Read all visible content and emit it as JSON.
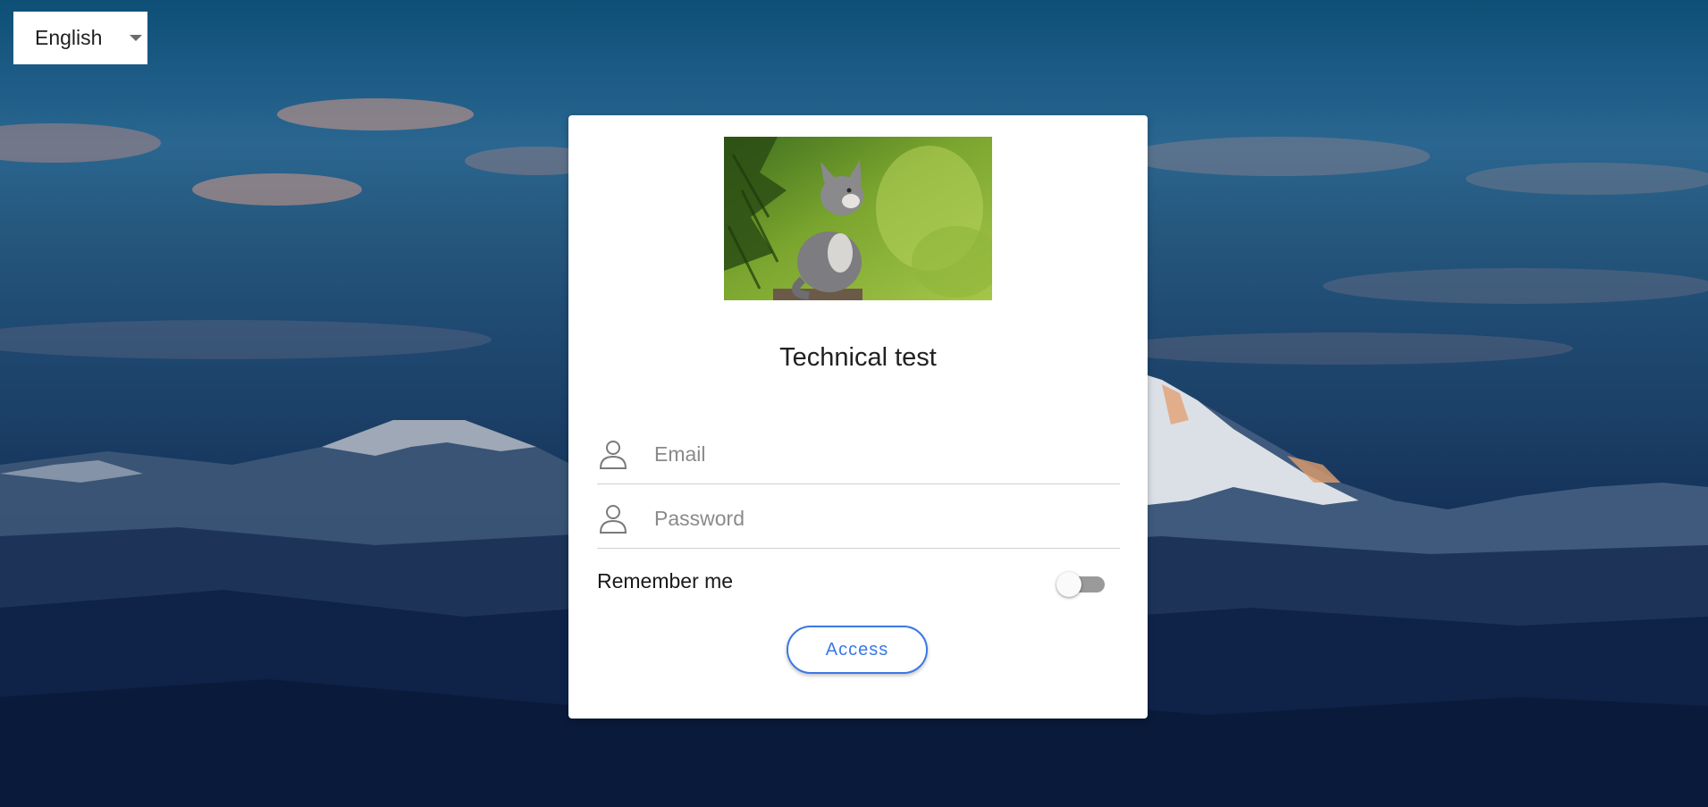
{
  "language_select": {
    "value": "English",
    "icon": "chevron-down-icon"
  },
  "login_card": {
    "logo_image": "kitten-photo",
    "title": "Technical test",
    "email": {
      "placeholder": "Email",
      "value": "",
      "icon": "user-icon"
    },
    "password": {
      "placeholder": "Password",
      "value": "",
      "icon": "user-icon"
    },
    "remember_me": {
      "label": "Remember me",
      "checked": false
    },
    "access_button": {
      "label": "Access",
      "color": "#3a78e6"
    }
  },
  "background": {
    "scene": "mountain-landscape-at-dusk"
  }
}
